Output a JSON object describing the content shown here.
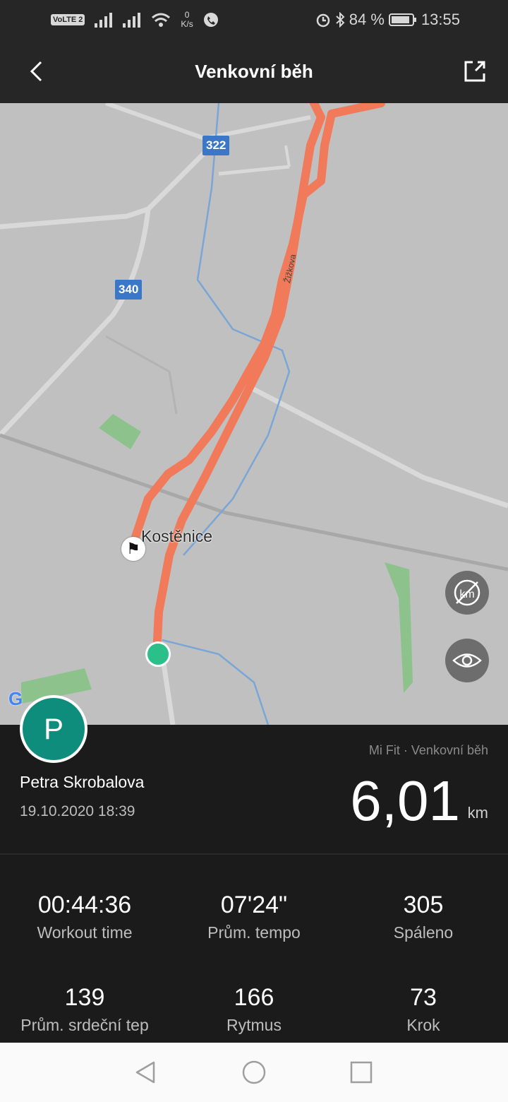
{
  "status": {
    "left": "0",
    "speed_unit": "K/s",
    "battery": "84 %",
    "time": "13:55",
    "volte": "VoLTE 2"
  },
  "header": {
    "title": "Venkovní běh"
  },
  "map": {
    "places": [
      "Kostěnice"
    ],
    "roads": [
      "322",
      "340"
    ],
    "street": "Žižkova"
  },
  "summary": {
    "avatar_letter": "P",
    "user_name": "Petra Skrobalova",
    "date": "19.10.2020 18:39",
    "source": "Mi Fit · Venkovní běh",
    "distance": "6,01",
    "distance_unit": "km"
  },
  "stats": [
    {
      "value": "00:44:36",
      "label": "Workout time"
    },
    {
      "value": "07'24\"",
      "label": "Prům. tempo"
    },
    {
      "value": "305",
      "label": "Spáleno"
    },
    {
      "value": "139",
      "label": "Prům. srdeční tep"
    },
    {
      "value": "166",
      "label": "Rytmus"
    },
    {
      "value": "73",
      "label": "Krok"
    }
  ],
  "colors": {
    "route": "#f07a5a",
    "start_dot": "#2bc08a",
    "avatar": "#0e8c7c"
  }
}
